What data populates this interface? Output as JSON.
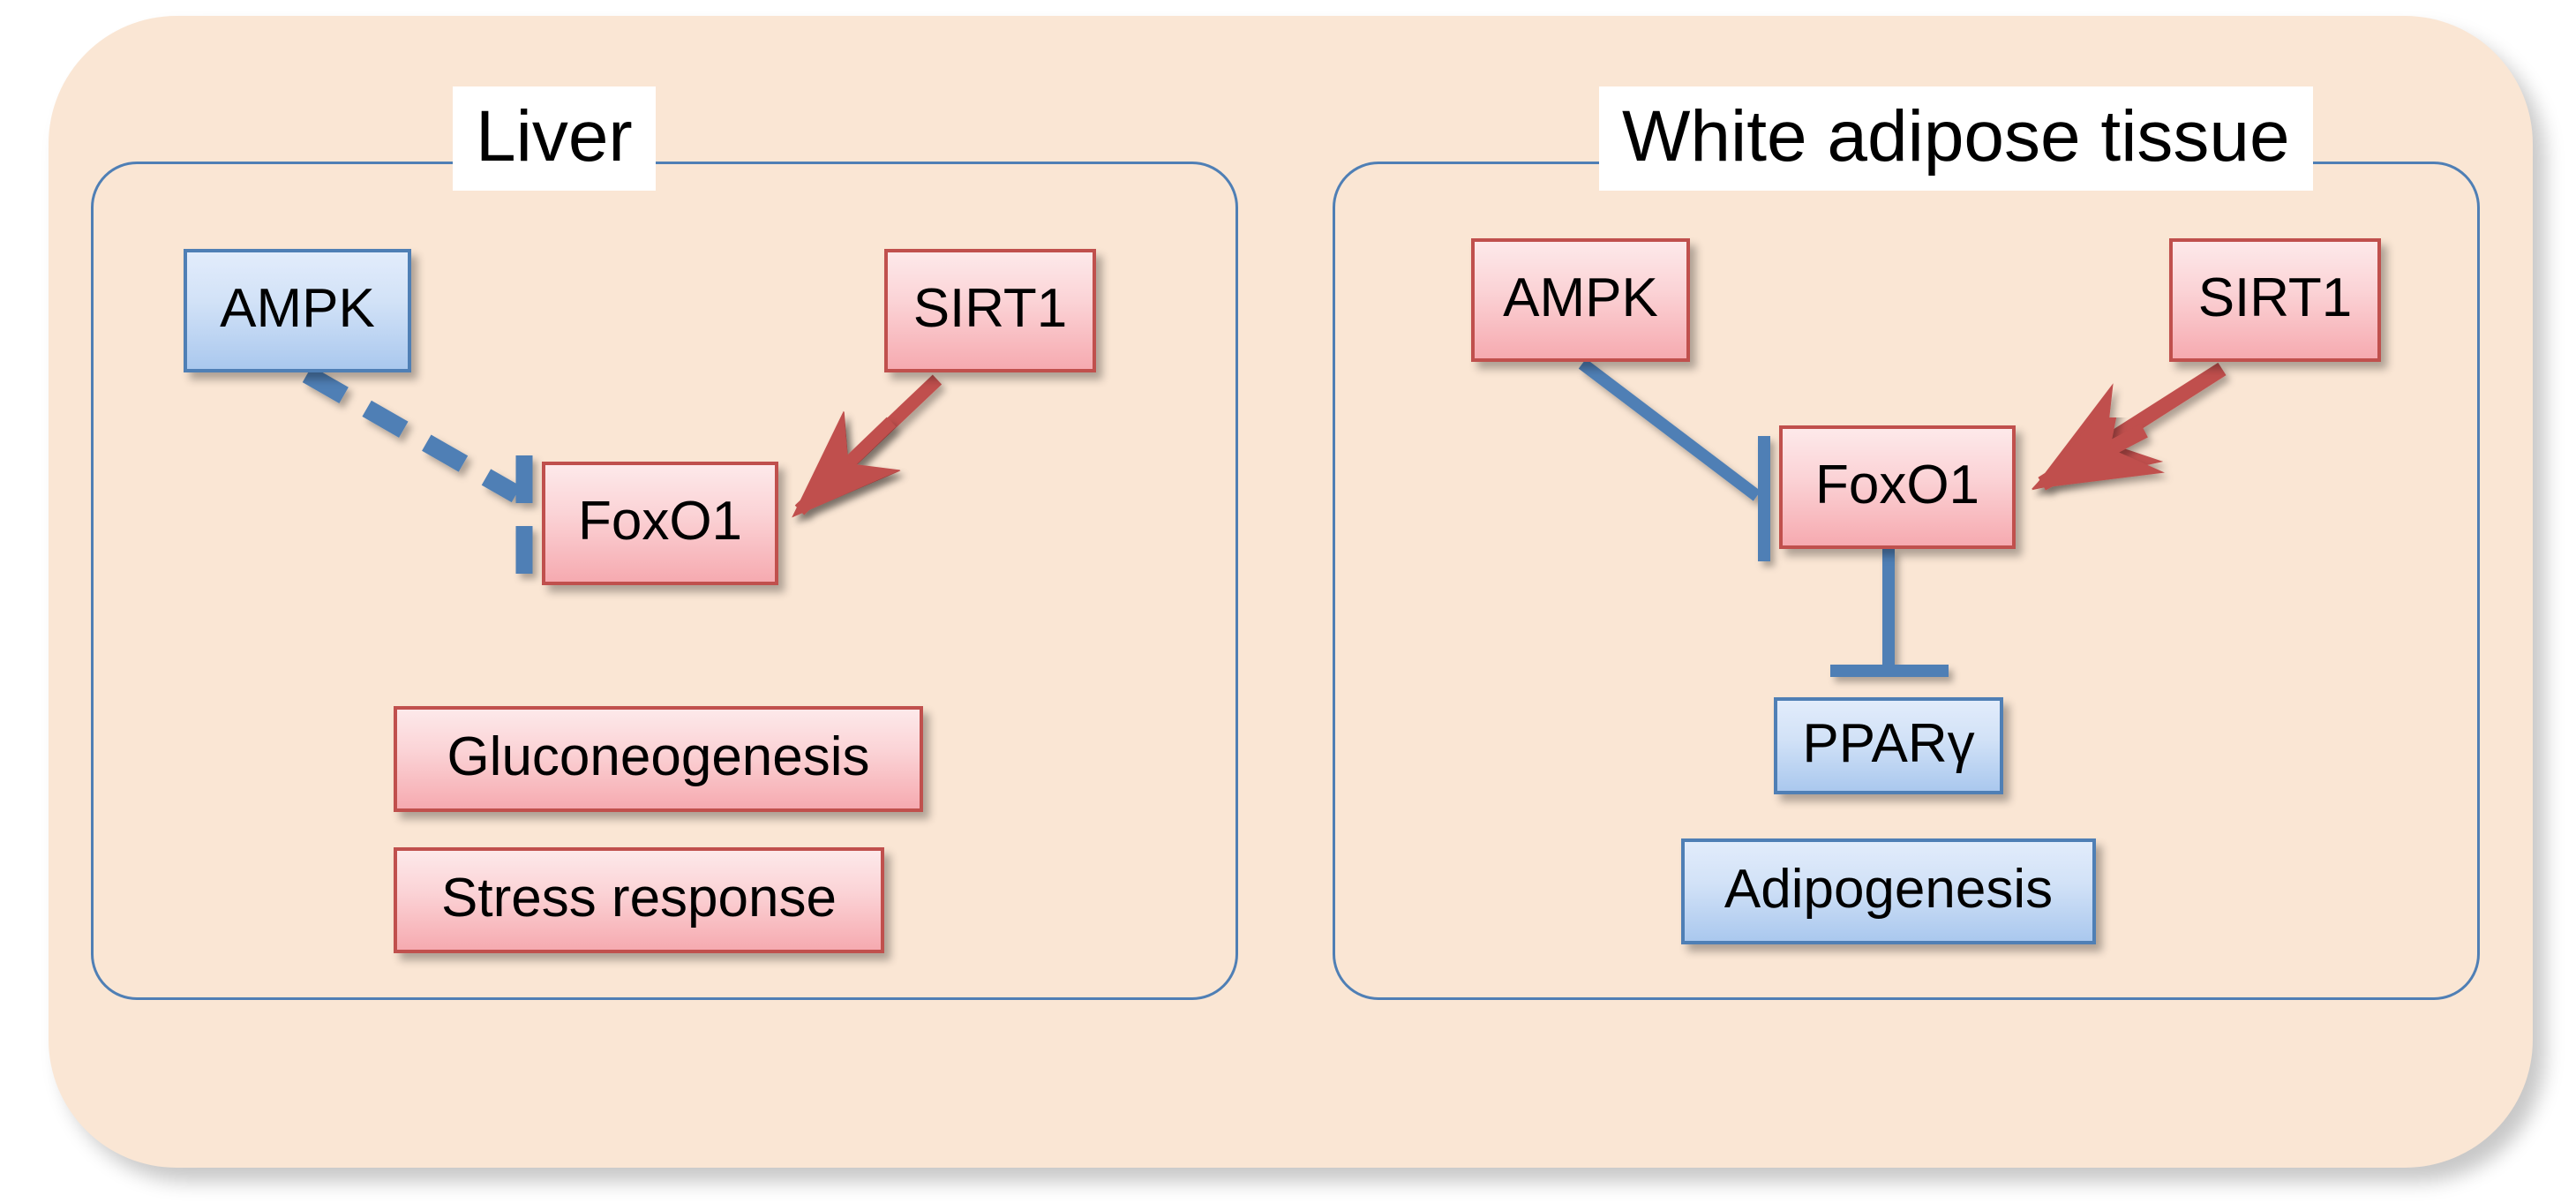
{
  "figure": {
    "type": "pathway-diagram",
    "background_color": "#fae6d4",
    "panel_border_color": "#4f7fb5",
    "accent_red": "#c0504d",
    "accent_blue": "#4f7fb5"
  },
  "panels": [
    {
      "id": "liver",
      "title": "Liver",
      "nodes": [
        {
          "id": "liver-ampk",
          "label": "AMPK",
          "color": "blue"
        },
        {
          "id": "liver-sirt1",
          "label": "SIRT1",
          "color": "red"
        },
        {
          "id": "liver-foxo1",
          "label": "FoxO1",
          "color": "red"
        },
        {
          "id": "liver-gluco",
          "label": "Gluconeogenesis",
          "color": "red"
        },
        {
          "id": "liver-stress",
          "label": "Stress response",
          "color": "red"
        }
      ],
      "edges": [
        {
          "from": "liver-ampk",
          "to": "liver-foxo1",
          "kind": "inhibition",
          "style": "dashed",
          "color": "#4f7fb5"
        },
        {
          "from": "liver-sirt1",
          "to": "liver-foxo1",
          "kind": "activation",
          "style": "solid",
          "color": "#c0504d"
        },
        {
          "from": "liver-foxo1",
          "to": "liver-gluco",
          "kind": "activation",
          "style": "solid",
          "color": "#c0504d"
        }
      ]
    },
    {
      "id": "wat",
      "title": "White adipose tissue",
      "nodes": [
        {
          "id": "wat-ampk",
          "label": "AMPK",
          "color": "red"
        },
        {
          "id": "wat-sirt1",
          "label": "SIRT1",
          "color": "red"
        },
        {
          "id": "wat-foxo1",
          "label": "FoxO1",
          "color": "red"
        },
        {
          "id": "wat-pparg",
          "label": "PPARγ",
          "color": "blue"
        },
        {
          "id": "wat-adipo",
          "label": "Adipogenesis",
          "color": "blue"
        }
      ],
      "edges": [
        {
          "from": "wat-ampk",
          "to": "wat-foxo1",
          "kind": "inhibition",
          "style": "solid",
          "color": "#4f7fb5"
        },
        {
          "from": "wat-sirt1",
          "to": "wat-foxo1",
          "kind": "activation",
          "style": "solid",
          "color": "#c0504d"
        },
        {
          "from": "wat-foxo1",
          "to": "wat-pparg",
          "kind": "inhibition",
          "style": "solid",
          "color": "#4f7fb5"
        }
      ]
    }
  ]
}
